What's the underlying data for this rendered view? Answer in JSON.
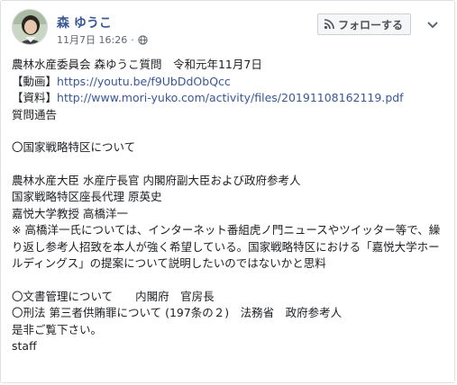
{
  "post": {
    "author": "森 ゆうこ",
    "date": "11月7日 16:26",
    "separator": "·",
    "follow_label": "フォローする"
  },
  "content": {
    "line1": "農林水産委員会 森ゆうこ質問　令和元年11月7日",
    "video_label": "【動画】",
    "video_url": "https://youtu.be/f9UbDdObQcc",
    "doc_label": "【資料】",
    "doc_url": "http://www.mori-yuko.com/activity/files/20191108162119.pdf",
    "notice": "質問通告",
    "section1_title": "〇国家戦略特区について",
    "section1_line1": "農林水産大臣 水産庁長官 内閣府副大臣および政府参考人",
    "section1_line2": "国家戦略特区座長代理 原英史",
    "section1_line3": "嘉悦大学教授 高橋洋一",
    "section1_note": "※ 高橋洋一氏については、インターネット番組虎ノ門ニュースやツイッター等で、繰り返し参考人招致を本人が強く希望している。国家戦略特区における「嘉悦大学ホールディングス」の提案について説明したいのではないかと思料",
    "section2": "〇文書管理について　　内閣府　官房長",
    "section3": "〇刑法 第三者供賄罪について (197条の２)　法務省　政府参考人",
    "closing": "是非ご覧下さい。",
    "signature": "staff"
  },
  "colors": {
    "link": "#385898",
    "text": "#1c1e21",
    "meta": "#616770",
    "button_bg": "#f5f6f7"
  },
  "icons": {
    "follow": "rss-icon",
    "privacy": "globe-icon",
    "menu": "chevron-down-icon"
  }
}
